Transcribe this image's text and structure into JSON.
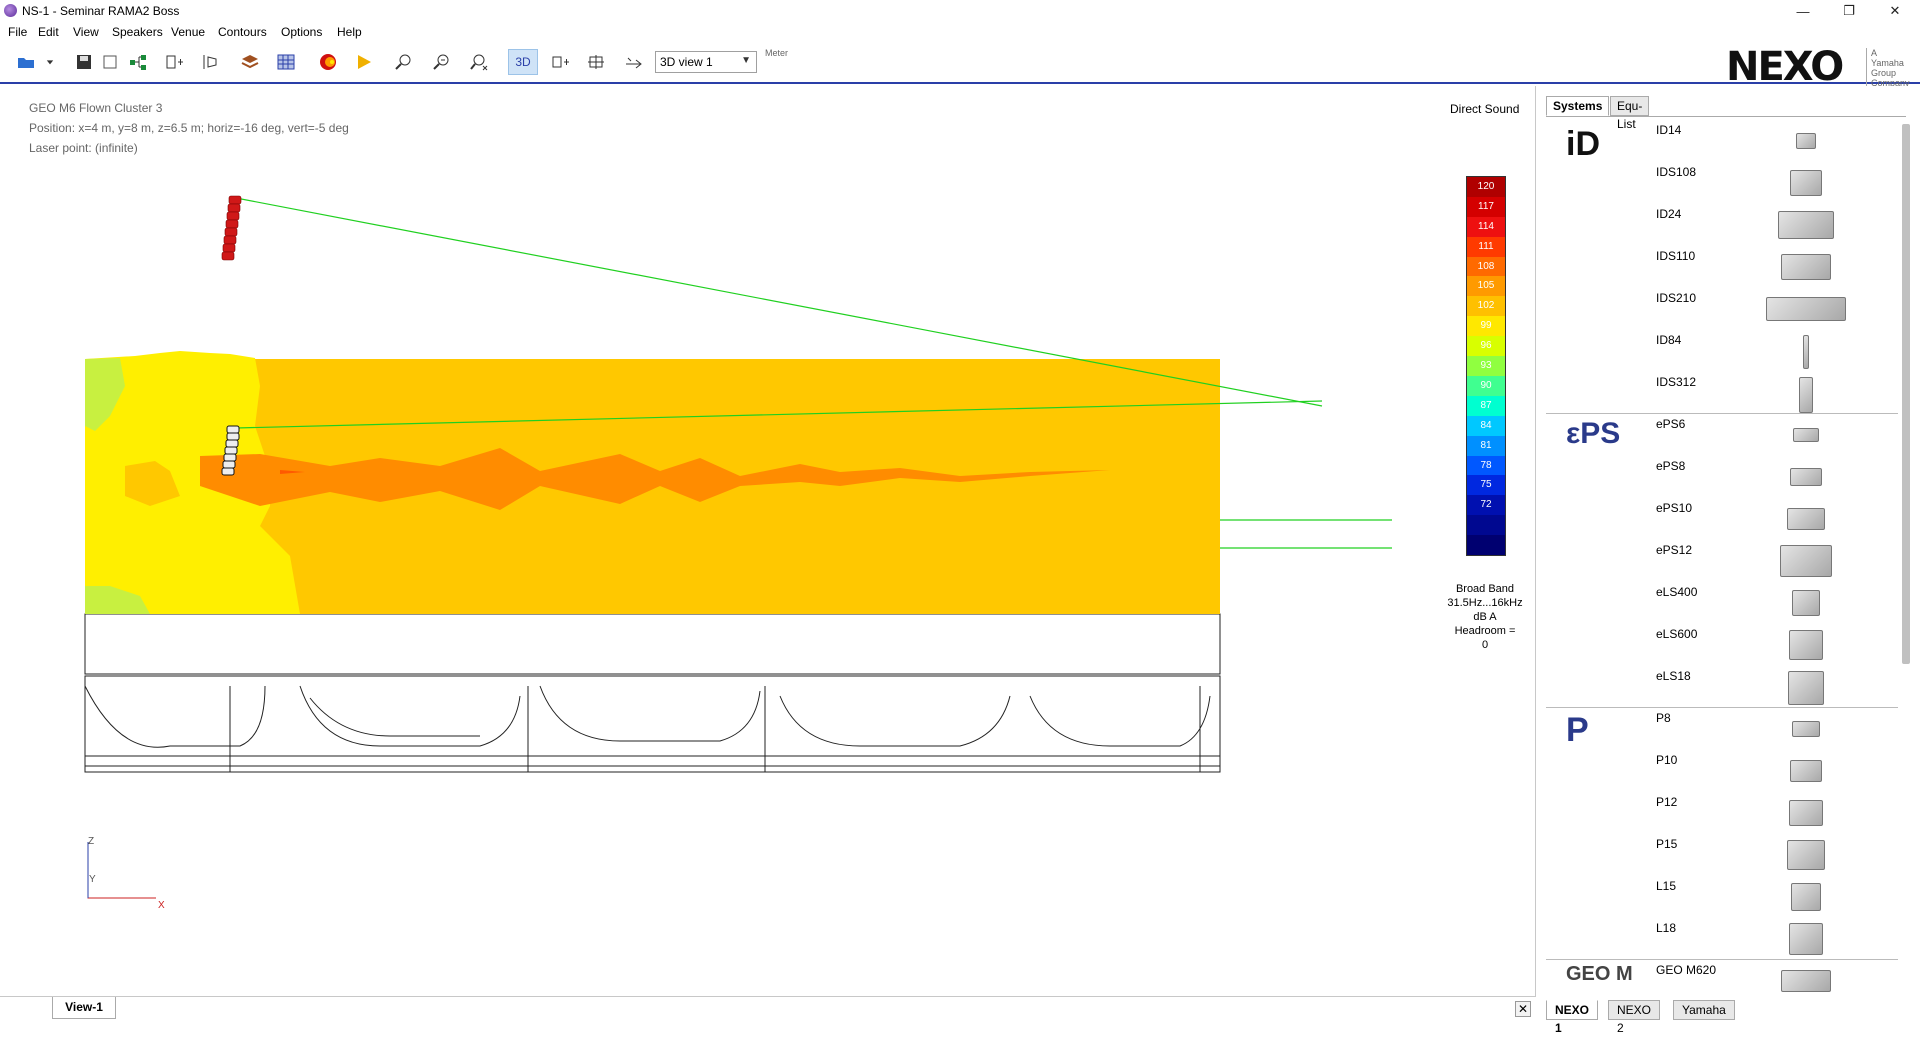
{
  "window": {
    "title": "NS-1 - Seminar RAMA2 Boss",
    "minimize": "—",
    "maximize": "❐",
    "close": "✕"
  },
  "menu": [
    "File",
    "Edit",
    "View",
    "Speakers",
    "Venue",
    "Contours",
    "Options",
    "Help"
  ],
  "toolbar": {
    "view_select": "3D view 1",
    "meter_label": "Meter",
    "mode_3d_label": "3D",
    "logo": "NEXO",
    "yamaha_lines": [
      "A",
      "Yamaha",
      "Group",
      "Company"
    ]
  },
  "viewport": {
    "info_title": "GEO M6 Flown Cluster 3",
    "info_position": "Position: x=4 m, y=8 m, z=6.5 m;  horiz=-16 deg, vert=-5 deg",
    "info_laser": "Laser point: (infinite)",
    "direct_sound": "Direct Sound",
    "broadband_lines": [
      "Broad Band",
      "31.5Hz...16kHz",
      "dB A",
      "Headroom =",
      "0"
    ],
    "axis_z": "Z",
    "axis_y": "Y",
    "axis_x": "X"
  },
  "scale": {
    "values": [
      "120",
      "117",
      "114",
      "111",
      "108",
      "105",
      "102",
      "99",
      "96",
      "93",
      "90",
      "87",
      "84",
      "81",
      "78",
      "75",
      "72",
      "",
      ""
    ],
    "colors": [
      "#b00000",
      "#d40000",
      "#ee1010",
      "#ff3a00",
      "#ff6a00",
      "#ff9a00",
      "#ffc000",
      "#ffe800",
      "#d8ff00",
      "#90ff40",
      "#40ff90",
      "#00ffd0",
      "#00c8ff",
      "#0090ff",
      "#0058ff",
      "#0028e0",
      "#0010b0",
      "#000890",
      "#000070"
    ]
  },
  "view_tabs": {
    "active": "View-1",
    "close": "✕"
  },
  "panel": {
    "tabs": [
      "Systems",
      "Equ-List"
    ],
    "bottom_tabs": [
      "NEXO 1",
      "NEXO 2",
      "Yamaha"
    ],
    "brands": [
      "iD",
      "εPS",
      "P",
      "GEO M"
    ],
    "items": [
      {
        "name": "ID14"
      },
      {
        "name": "IDS108"
      },
      {
        "name": "ID24"
      },
      {
        "name": "IDS110"
      },
      {
        "name": "IDS210"
      },
      {
        "name": "ID84"
      },
      {
        "name": "IDS312"
      },
      {
        "name": "ePS6"
      },
      {
        "name": "ePS8"
      },
      {
        "name": "ePS10"
      },
      {
        "name": "ePS12"
      },
      {
        "name": "eLS400"
      },
      {
        "name": "eLS600"
      },
      {
        "name": "eLS18"
      },
      {
        "name": "P8"
      },
      {
        "name": "P10"
      },
      {
        "name": "P12"
      },
      {
        "name": "P15"
      },
      {
        "name": "L15"
      },
      {
        "name": "L18"
      },
      {
        "name": "GEO M620"
      }
    ]
  }
}
